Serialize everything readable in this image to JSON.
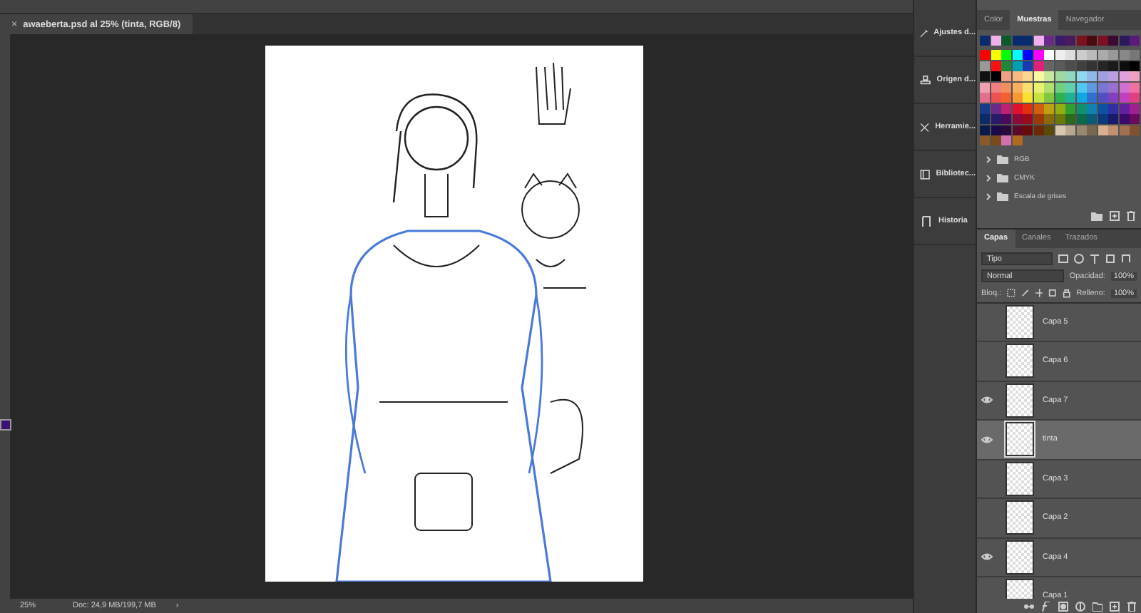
{
  "document_tab": {
    "close": "×",
    "title": "awaeberta.psd al 25% (tinta, RGB/8)"
  },
  "tool_strip": {
    "foreground": {
      "color": "#3a1470"
    }
  },
  "status_bar": {
    "zoom": "25%",
    "doc_size": "Doc: 24,9 MB/199,7 MB",
    "arrow": "›"
  },
  "dock_items": [
    {
      "kind": "adjust",
      "label": "Ajustes d..."
    },
    {
      "kind": "stamp",
      "label": "Origen d..."
    },
    {
      "kind": "tools",
      "label": "Herramie..."
    },
    {
      "kind": "library",
      "label": "Bibliotec..."
    },
    {
      "kind": "history",
      "label": "Historia"
    }
  ],
  "swatch_panel": {
    "tabs": [
      {
        "label": "Color",
        "selected": false
      },
      {
        "label": "Muestras",
        "selected": true
      },
      {
        "label": "Navegador",
        "selected": false
      }
    ],
    "recent": [
      {
        "color": "#0a2a6e"
      },
      {
        "color": "#f0b0e8"
      },
      {
        "color": "#0a5a2a"
      },
      {
        "color": "#0a2a6e"
      },
      {
        "color": "#0a2a6e"
      },
      {
        "color": "#f0b0f0"
      },
      {
        "color": "#6a2a8a"
      },
      {
        "color": "#3a1a6a"
      },
      {
        "color": "#4a1a5a"
      },
      {
        "color": "#7a1020"
      },
      {
        "color": "#4a0a10"
      },
      {
        "color": "#7a1020"
      },
      {
        "color": "#3a0a30"
      },
      {
        "color": "#2a1a5a"
      },
      {
        "color": "#5a1a7a"
      }
    ],
    "swatches": [
      {
        "color": "#ff0000"
      },
      {
        "color": "#ffff00"
      },
      {
        "color": "#00ff00"
      },
      {
        "color": "#00ffff"
      },
      {
        "color": "#0000ff"
      },
      {
        "color": "#ff00ff"
      },
      {
        "color": "#ffffff"
      },
      {
        "color": "#eeeeee"
      },
      {
        "color": "#dddddd"
      },
      {
        "color": "#cccccc"
      },
      {
        "color": "#bbbbbb"
      },
      {
        "color": "#aaaaaa"
      },
      {
        "color": "#999999"
      },
      {
        "color": "#888888"
      },
      {
        "color": "#777777"
      },
      {
        "color": "#999998"
      },
      {
        "color": "#ff1010"
      },
      {
        "color": "#1a8a3a"
      },
      {
        "color": "#00a0b0"
      },
      {
        "color": "#1a3ab0"
      },
      {
        "color": "#e0207a"
      },
      {
        "color": "#666666"
      },
      {
        "color": "#5a5a5a"
      },
      {
        "color": "#4d4d4d"
      },
      {
        "color": "#404040"
      },
      {
        "color": "#333333"
      },
      {
        "color": "#262626"
      },
      {
        "color": "#1a1a1a"
      },
      {
        "color": "#0d0d0d"
      },
      {
        "color": "#000000"
      },
      {
        "color": "#111111"
      },
      {
        "color": "#000001"
      },
      {
        "color": "#f0a080"
      },
      {
        "color": "#f8b880"
      },
      {
        "color": "#f8d890"
      },
      {
        "color": "#f8f8a0"
      },
      {
        "color": "#c8e8a0"
      },
      {
        "color": "#a0d8a0"
      },
      {
        "color": "#90d8c0"
      },
      {
        "color": "#90d8f0"
      },
      {
        "color": "#90b8e8"
      },
      {
        "color": "#a0a0e0"
      },
      {
        "color": "#b8a0e0"
      },
      {
        "color": "#e0a0e0"
      },
      {
        "color": "#f0a0c0"
      },
      {
        "color": "#f0a0b0"
      },
      {
        "color": "#f08080"
      },
      {
        "color": "#f09060"
      },
      {
        "color": "#f8b060"
      },
      {
        "color": "#f8e070"
      },
      {
        "color": "#e8f070"
      },
      {
        "color": "#b0e070"
      },
      {
        "color": "#70d080"
      },
      {
        "color": "#60d0b0"
      },
      {
        "color": "#50c8f0"
      },
      {
        "color": "#6098e0"
      },
      {
        "color": "#7878d0"
      },
      {
        "color": "#9870d0"
      },
      {
        "color": "#d070d0"
      },
      {
        "color": "#f070a0"
      },
      {
        "color": "#e07090"
      },
      {
        "color": "#f05050"
      },
      {
        "color": "#f06030"
      },
      {
        "color": "#f89830"
      },
      {
        "color": "#f8e030"
      },
      {
        "color": "#c8e040"
      },
      {
        "color": "#80c840"
      },
      {
        "color": "#30b050"
      },
      {
        "color": "#20b098"
      },
      {
        "color": "#10a8e0"
      },
      {
        "color": "#3070d0"
      },
      {
        "color": "#5050c0"
      },
      {
        "color": "#8040c0"
      },
      {
        "color": "#c040c0"
      },
      {
        "color": "#e04080"
      },
      {
        "color": "#1a3a8a"
      },
      {
        "color": "#6a2a8a"
      },
      {
        "color": "#c02070"
      },
      {
        "color": "#e01030"
      },
      {
        "color": "#e03010"
      },
      {
        "color": "#d06010"
      },
      {
        "color": "#c0a010"
      },
      {
        "color": "#90b010"
      },
      {
        "color": "#30a030"
      },
      {
        "color": "#109070"
      },
      {
        "color": "#1080b0"
      },
      {
        "color": "#1050a0"
      },
      {
        "color": "#3030a0"
      },
      {
        "color": "#6020a0"
      },
      {
        "color": "#a02090"
      },
      {
        "color": "#0a2a6a"
      },
      {
        "color": "#2a1a6a"
      },
      {
        "color": "#4a0a5a"
      },
      {
        "color": "#8a0a3a"
      },
      {
        "color": "#9a0a1a"
      },
      {
        "color": "#9a3a0a"
      },
      {
        "color": "#8a6a0a"
      },
      {
        "color": "#6a7a0a"
      },
      {
        "color": "#2a6a1a"
      },
      {
        "color": "#0a6a4a"
      },
      {
        "color": "#0a5a7a"
      },
      {
        "color": "#0a3a7a"
      },
      {
        "color": "#1a1a6a"
      },
      {
        "color": "#3a0a6a"
      },
      {
        "color": "#6a0a5a"
      },
      {
        "color": "#0a1a4a"
      },
      {
        "color": "#1a0a4a"
      },
      {
        "color": "#2a0a3a"
      },
      {
        "color": "#5a0a2a"
      },
      {
        "color": "#6a0a0a"
      },
      {
        "color": "#6a2a0a"
      },
      {
        "color": "#5a4a0a"
      },
      {
        "color": "#d8c8b0"
      },
      {
        "color": "#b8a890"
      },
      {
        "color": "#988870"
      },
      {
        "color": "#786850"
      },
      {
        "color": "#d8b090"
      },
      {
        "color": "#c09070"
      },
      {
        "color": "#a07050"
      },
      {
        "color": "#805030"
      },
      {
        "color": "#8a5a2a"
      },
      {
        "color": "#7a4a1a"
      },
      {
        "color": "#d070b0"
      },
      {
        "color": "#b06a20"
      }
    ],
    "groups": [
      {
        "label": "RGB"
      },
      {
        "label": "CMYK"
      },
      {
        "label": "Escala de grises"
      }
    ]
  },
  "layers_panel": {
    "tabs": [
      {
        "label": "Capas",
        "selected": true
      },
      {
        "label": "Canales",
        "selected": false
      },
      {
        "label": "Trazados",
        "selected": false
      }
    ],
    "filter": "Tipo",
    "blend_mode": "Normal",
    "opacity_label": "Opacidad:",
    "opacity": "100%",
    "lock_label": "Bloq.:",
    "fill_label": "Relleno:",
    "fill": "100%",
    "layers": [
      {
        "name": "Capa 5",
        "visible": false,
        "selected": false
      },
      {
        "name": "Capa 6",
        "visible": false,
        "selected": false
      },
      {
        "name": "Capa 7",
        "visible": true,
        "selected": false
      },
      {
        "name": "tinta",
        "visible": true,
        "selected": true
      },
      {
        "name": "Capa 3",
        "visible": false,
        "selected": false
      },
      {
        "name": "Capa 2",
        "visible": false,
        "selected": false
      },
      {
        "name": "Capa 4",
        "visible": true,
        "selected": false
      },
      {
        "name": "Capa 1",
        "visible": false,
        "selected": false
      }
    ]
  }
}
